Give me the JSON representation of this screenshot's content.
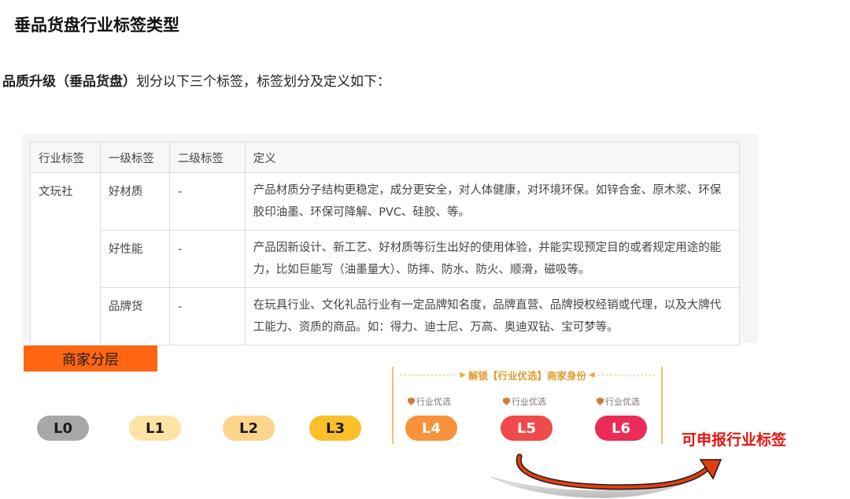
{
  "page_title": "垂品货盘行业标签类型",
  "intro": {
    "bold": "品质升级（垂品货盘）",
    "rest": "划分以下三个标签，标签划分及定义如下："
  },
  "table": {
    "headers": [
      "行业标签",
      "一级标签",
      "二级标签",
      "定义"
    ],
    "industry": "文玩社",
    "rows": [
      {
        "level1": "好材质",
        "level2": "-",
        "definition": "产品材质分子结构更稳定，成分更安全，对人体健康，对环境环保。如锌合金、原木浆、环保胶印油墨、环保可降解、PVC、硅胶、等。"
      },
      {
        "level1": "好性能",
        "level2": "-",
        "definition": "产品因新设计、新工艺、好材质等衍生出好的使用体验，并能实现预定目的或者规定用途的能力，比如巨能写（油墨量大）、防摔、防水、防火、顺滑，磁吸等。"
      },
      {
        "level1": "品牌货",
        "level2": "-",
        "definition": "在玩具行业、文化礼品行业有一定品牌知名度，品牌直营、品牌授权经销或代理，以及大牌代工能力、资质的商品。如：得力、迪士尼、万高、奥迪双钻、宝可梦等。"
      }
    ]
  },
  "section_label": "商家分层",
  "unlock_title": "解锁【行业优选】商家身份",
  "badge_label": "行业优选",
  "levels": [
    {
      "label": "L0",
      "bg": "#a8a8a8",
      "fg": "#1a1a1a"
    },
    {
      "label": "L1",
      "bg": "#fde4a5",
      "fg": "#1a1a1a"
    },
    {
      "label": "L2",
      "bg": "#fdd58a",
      "fg": "#1a1a1a"
    },
    {
      "label": "L3",
      "bg": "#fbbf2a",
      "fg": "#1a1a1a"
    },
    {
      "label": "L4",
      "bg": "#f8913a",
      "fg": "#ffffff"
    },
    {
      "label": "L5",
      "bg": "#f14a4a",
      "fg": "#ffffff"
    },
    {
      "label": "L6",
      "bg": "#ea2c57",
      "fg": "#ffffff"
    }
  ],
  "report_label": "可申报行业标签",
  "colors": {
    "accent": "#ff6611",
    "report": "#e3150f",
    "unlock": "#e39a2b"
  }
}
